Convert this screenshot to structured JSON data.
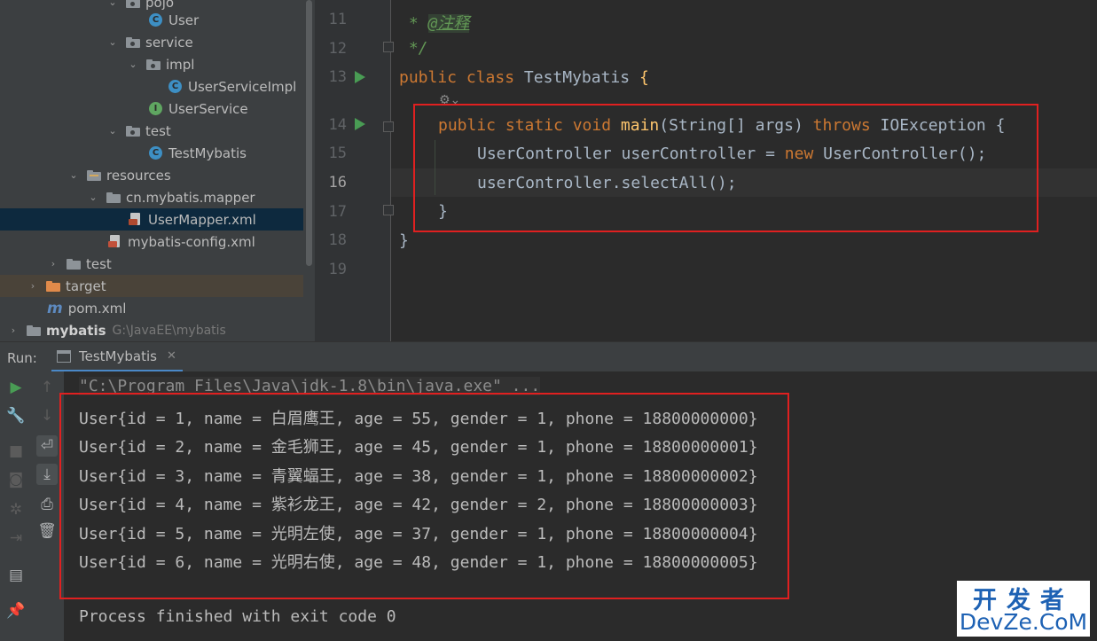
{
  "project_tree": {
    "items": [
      {
        "label": "pojo",
        "kind": "package"
      },
      {
        "label": "User",
        "kind": "class"
      },
      {
        "label": "service",
        "kind": "package"
      },
      {
        "label": "impl",
        "kind": "package"
      },
      {
        "label": "UserServiceImpl",
        "kind": "class"
      },
      {
        "label": "UserService",
        "kind": "interface"
      },
      {
        "label": "test",
        "kind": "package"
      },
      {
        "label": "TestMybatis",
        "kind": "class"
      },
      {
        "label": "resources",
        "kind": "resource-folder"
      },
      {
        "label": "cn.mybatis.mapper",
        "kind": "folder"
      },
      {
        "label": "UserMapper.xml",
        "kind": "mapper-xml"
      },
      {
        "label": "mybatis-config.xml",
        "kind": "xml"
      },
      {
        "label": "test",
        "kind": "folder"
      },
      {
        "label": "target",
        "kind": "excluded-folder"
      },
      {
        "label": "pom.xml",
        "kind": "maven"
      },
      {
        "label": "mybatis",
        "kind": "project"
      }
    ],
    "project_path": "G:\\JavaEE\\mybatis"
  },
  "editor": {
    "line_numbers": [
      "11",
      "12",
      "13",
      "14",
      "15",
      "16",
      "17",
      "18",
      "19"
    ],
    "lines": {
      "l11_star": " * ",
      "l11_tag": "@注释",
      "l12": " */",
      "l13_kw": "public class ",
      "l13_name": "TestMybatis",
      "l13_rest": " {",
      "l14_kw": "public static void ",
      "l14_fn": "main",
      "l14_mid": "(String[] args) ",
      "l14_kw2": "throws",
      "l14_rest": " IOException {",
      "l15_a": "UserController userController = ",
      "l15_kw": "new",
      "l15_b": " UserController();",
      "l16": "userController.selectAll();",
      "l17": "}",
      "l18": "}"
    }
  },
  "run_panel": {
    "label": "Run:",
    "tab_title": "TestMybatis",
    "command": "\"C:\\Program Files\\Java\\jdk-1.8\\bin\\java.exe\" ...",
    "output": [
      "User{id = 1, name = 白眉鹰王, age = 55, gender = 1, phone = 18800000000}",
      "User{id = 2, name = 金毛狮王, age = 45, gender = 1, phone = 18800000001}",
      "User{id = 3, name = 青翼蝠王, age = 38, gender = 1, phone = 18800000002}",
      "User{id = 4, name = 紫衫龙王, age = 42, gender = 2, phone = 18800000003}",
      "User{id = 5, name = 光明左使, age = 37, gender = 1, phone = 18800000004}",
      "User{id = 6, name = 光明右使, age = 48, gender = 1, phone = 18800000005}"
    ],
    "exit_message": "Process finished with exit code 0"
  },
  "watermark": {
    "top": "开发者",
    "bottom": "DevZe.CoM"
  },
  "colors": {
    "accent_green": "#499c54",
    "highlight_box": "#e02020",
    "keyword": "#cc7832",
    "function": "#ffc66d"
  }
}
